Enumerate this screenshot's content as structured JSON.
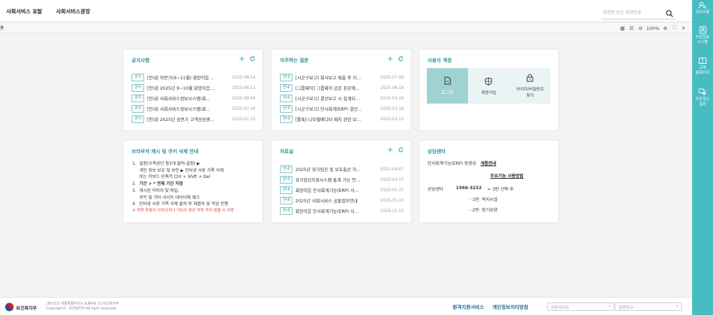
{
  "topnav": {
    "portal": "사회서비스 포탈",
    "plaza": "사회서비스광장"
  },
  "search": {
    "placeholder": "화면명 또는 화면번호"
  },
  "tabbar": {
    "home": "홈",
    "zoom": "100%"
  },
  "notice": {
    "title": "공지사항",
    "items": [
      {
        "badge": "공지",
        "text": "[안내] 하반기(9~11월) 회망이음 ...",
        "date": "2025-08-14"
      },
      {
        "badge": "공지",
        "text": "[안내] 2025년 9~10월 회망이음 ...",
        "date": "2025-08-11"
      },
      {
        "badge": "공지",
        "text": "[안내] 사회서비스정보시스템(회...",
        "date": "2025-08-04"
      },
      {
        "badge": "공지",
        "text": "[안내] 사회서비스정보시스템(회...",
        "date": "2025-07-24"
      },
      {
        "badge": "공지",
        "text": "[안내] 2025년 상반기 고객상담센...",
        "date": "2025-07-15"
      }
    ]
  },
  "faq": {
    "title": "자주하는 질문",
    "items": [
      {
        "badge": "안내",
        "text": "[시군구보고] 회사보고 제출 후 지...",
        "date": "2025-07-09"
      },
      {
        "badge": "안내",
        "text": "[그룹웨어] 그룹웨어 공문 본문에...",
        "date": "2025-06-18"
      },
      {
        "badge": "안내",
        "text": "[시군구보고] 결산보고 시 집계되...",
        "date": "2025-03-20"
      },
      {
        "badge": "안내",
        "text": "[시군구보고] 인사회계(ERP) 결산...",
        "date": "2025-03-18"
      },
      {
        "badge": "안내",
        "text": "[툴툭] 나모웹에디터 패치 관련 보...",
        "date": "2025-03-13"
      }
    ]
  },
  "account": {
    "title": "사용자 계정",
    "login": "로그인",
    "join": "회원가입",
    "find": [
      "아이디/비밀번호",
      "찾기"
    ]
  },
  "browser_guide": {
    "title": "브라우저 캐시 및 쿠키 삭제 안내",
    "lines": [
      {
        "num": "1.",
        "text": "설정(우측상단 점3개 클릭-설정) ▶"
      },
      {
        "num": "",
        "text": "개인 정보 보호 및 보안 ▶ 인터넷 사용 기록 삭제"
      },
      {
        "num": "",
        "text": "또는 키보드 단축키 Ctrl + Shift + Del"
      },
      {
        "num": "2.",
        "text": "기간    >   * 전체 기간 지정"
      },
      {
        "num": "3.",
        "text": "캐시된 이미지 및 파일,"
      },
      {
        "num": "",
        "text": "쿠키 및 기타 사이트 데이터에 체크"
      },
      {
        "num": "4.",
        "text": "인터넷 사용 기록 삭제 클릭 후 재접속 및 작업 진행"
      }
    ],
    "warning": "※ 화면 후험이 지속되거나 기능이 정상 작동 하지 않을 시 이용"
  },
  "library": {
    "title": "자료실",
    "items": [
      {
        "badge": "안내",
        "text": "2025년 위기임신 및 보호출산 지...",
        "date": "2025-04-07"
      },
      {
        "badge": "안내",
        "text": "위기임신지원시스템 통계 기능 안...",
        "date": "2025-03-17"
      },
      {
        "badge": "안내",
        "text": "회망이음 인사회계기능(ERP) 사...",
        "date": "2025-01-31"
      },
      {
        "badge": "안내",
        "text": "2025년 사회서비스 공통업무안내",
        "date": "2025-01-10"
      },
      {
        "badge": "안내",
        "text": "회망이음 인사회계기능(ERP) 사...",
        "date": "2024-11-13"
      }
    ]
  },
  "consult": {
    "title": "상담센터",
    "erp_text": "인사회계기능(ERP) 동영상",
    "erp_link": "개통안내",
    "major_link": "주요기능 사용방법",
    "center_label": "상담센터",
    "phone": "1566-3232",
    "phone_after": "> 3번 선택 후",
    "sub1": "- 1번: 복지시설",
    "sub2": "- 2번: 장기요양"
  },
  "footer": {
    "org": "보건복지부",
    "addr": "(30113) 세종특별자치시 도움4로 13 보건복지부",
    "copy": "Copyright©. 보건복지부 All right reserved.",
    "link1": "원격지원서비스",
    "link2": "개인정보처리방침",
    "select1": "관련사이트",
    "select2": "관련링크"
  },
  "rightbar": {
    "items": [
      "공지사항",
      "사업정보\n시스템",
      "교육\n홈페이지",
      "자주하는\n질문"
    ]
  },
  "colors": {
    "accent": "#47bcc1",
    "teal_text": "#2f8f93"
  }
}
